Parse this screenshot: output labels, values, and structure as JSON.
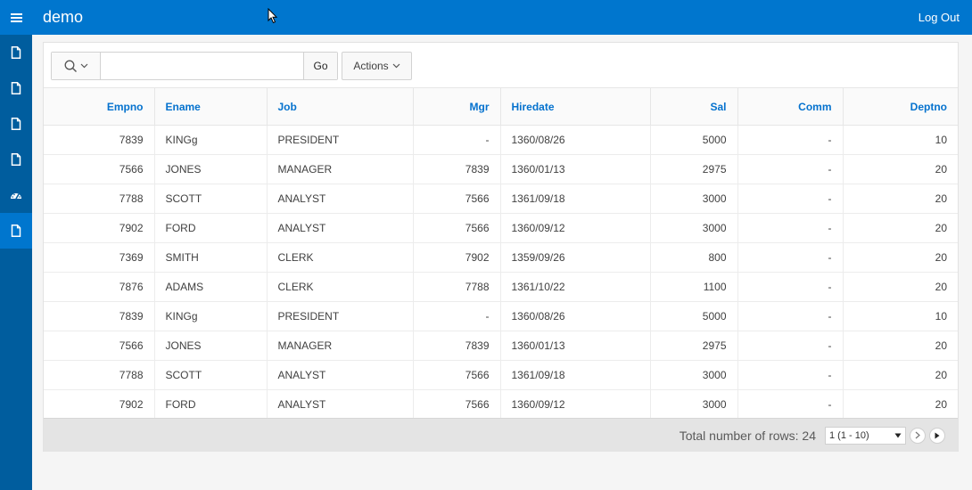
{
  "header": {
    "app_title": "demo",
    "logout_label": "Log Out"
  },
  "sidenav": {
    "items": [
      {
        "icon": "page-icon"
      },
      {
        "icon": "page-icon"
      },
      {
        "icon": "page-icon"
      },
      {
        "icon": "page-icon"
      },
      {
        "icon": "dashboard-icon"
      },
      {
        "icon": "page-icon",
        "active": true
      }
    ]
  },
  "toolbar": {
    "search_value": "",
    "go_label": "Go",
    "actions_label": "Actions"
  },
  "table": {
    "columns": [
      "Empno",
      "Ename",
      "Job",
      "Mgr",
      "Hiredate",
      "Sal",
      "Comm",
      "Deptno"
    ],
    "rows": [
      [
        "7839",
        "KINGg",
        "PRESIDENT",
        "-",
        "1360/08/26",
        "5000",
        "-",
        "10"
      ],
      [
        "7566",
        "JONES",
        "MANAGER",
        "7839",
        "1360/01/13",
        "2975",
        "-",
        "20"
      ],
      [
        "7788",
        "SCOTT",
        "ANALYST",
        "7566",
        "1361/09/18",
        "3000",
        "-",
        "20"
      ],
      [
        "7902",
        "FORD",
        "ANALYST",
        "7566",
        "1360/09/12",
        "3000",
        "-",
        "20"
      ],
      [
        "7369",
        "SMITH",
        "CLERK",
        "7902",
        "1359/09/26",
        "800",
        "-",
        "20"
      ],
      [
        "7876",
        "ADAMS",
        "CLERK",
        "7788",
        "1361/10/22",
        "1100",
        "-",
        "20"
      ],
      [
        "7839",
        "KINGg",
        "PRESIDENT",
        "-",
        "1360/08/26",
        "5000",
        "-",
        "10"
      ],
      [
        "7566",
        "JONES",
        "MANAGER",
        "7839",
        "1360/01/13",
        "2975",
        "-",
        "20"
      ],
      [
        "7788",
        "SCOTT",
        "ANALYST",
        "7566",
        "1361/09/18",
        "3000",
        "-",
        "20"
      ],
      [
        "7902",
        "FORD",
        "ANALYST",
        "7566",
        "1360/09/12",
        "3000",
        "-",
        "20"
      ]
    ]
  },
  "footer": {
    "total_rows_text": "Total number of rows: 24",
    "pagination_value": "1 (1 - 10)"
  },
  "colors": {
    "header_bg": "#0076ce",
    "sidenav_bg": "#005d9e",
    "column_header_text": "#0572ce"
  }
}
